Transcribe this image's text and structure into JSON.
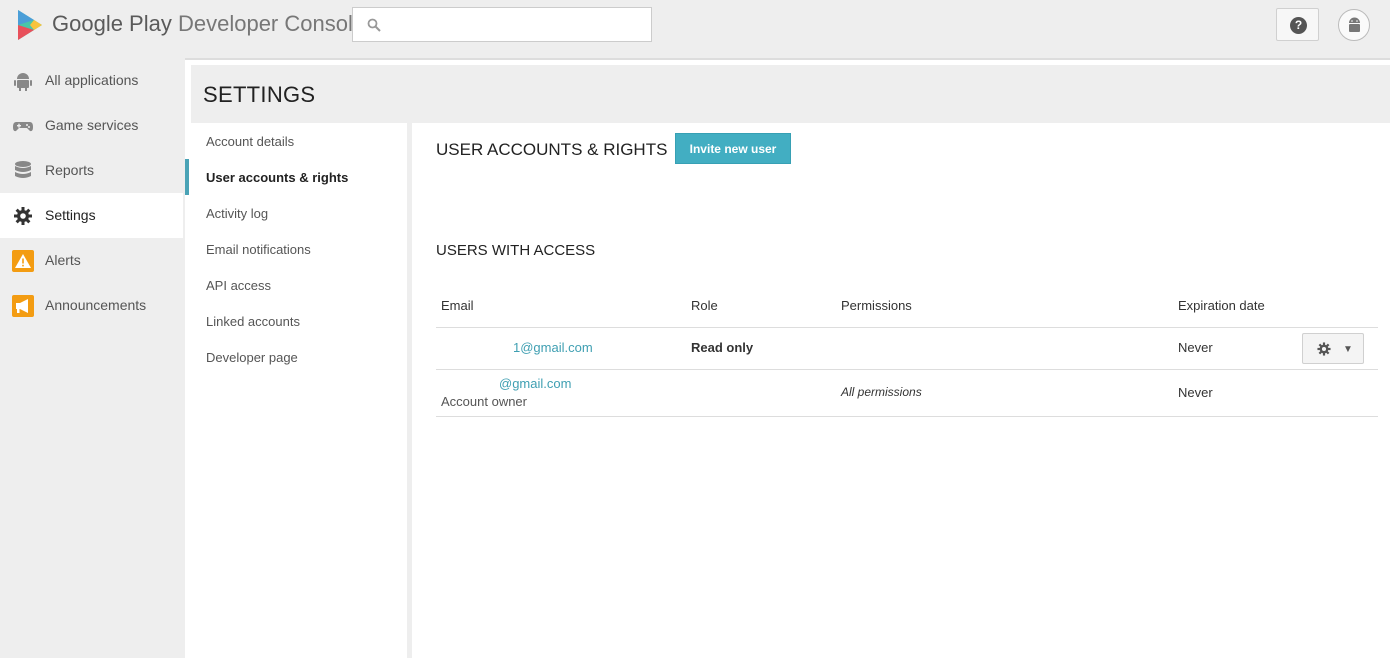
{
  "header": {
    "brand": "Google Play",
    "product": "Developer Console",
    "search": {
      "value": "",
      "placeholder": ""
    },
    "help_icon": "?"
  },
  "leftnav": {
    "items": [
      {
        "label": "All applications",
        "icon": "android-icon"
      },
      {
        "label": "Game services",
        "icon": "gamepad-icon"
      },
      {
        "label": "Reports",
        "icon": "database-icon"
      },
      {
        "label": "Settings",
        "icon": "gear-icon",
        "active": true
      },
      {
        "label": "Alerts",
        "icon": "warning-icon"
      },
      {
        "label": "Announcements",
        "icon": "megaphone-icon"
      }
    ]
  },
  "settings": {
    "title": "SETTINGS",
    "subnav": [
      {
        "label": "Account details"
      },
      {
        "label": "User accounts & rights",
        "active": true
      },
      {
        "label": "Activity log"
      },
      {
        "label": "Email notifications"
      },
      {
        "label": "API access"
      },
      {
        "label": "Linked accounts"
      },
      {
        "label": "Developer page"
      }
    ]
  },
  "content": {
    "title": "USER ACCOUNTS & RIGHTS",
    "invite_label": "Invite new user",
    "users_title": "USERS WITH ACCESS",
    "table": {
      "headers": [
        "Email",
        "Role",
        "Permissions",
        "Expiration date"
      ],
      "rows": [
        {
          "email": "1@gmail.com",
          "note": "",
          "role": "Read only",
          "permissions": "",
          "expiration": "Never"
        },
        {
          "email": "@gmail.com",
          "note": "Account owner",
          "role": "",
          "permissions": "All permissions",
          "expiration": "Never"
        }
      ]
    }
  },
  "colors": {
    "accent": "#42aec2",
    "link": "#3f9fb2",
    "alert_orange": "#f39c12",
    "background": "#eeeeee"
  }
}
